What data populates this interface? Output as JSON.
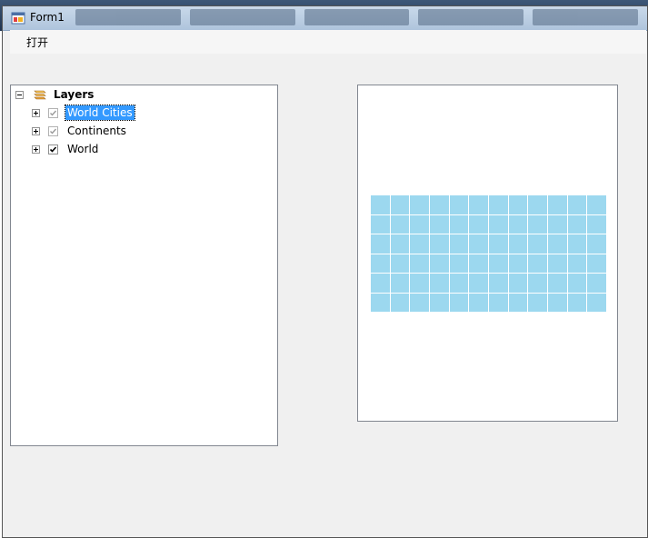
{
  "window": {
    "title": "Form1"
  },
  "menu": {
    "items": [
      {
        "label": "打开"
      }
    ]
  },
  "toc": {
    "root": {
      "label": "Layers"
    },
    "layers": [
      {
        "label": "World Cities",
        "checked": true,
        "dimmed": true,
        "selected": true
      },
      {
        "label": "Continents",
        "checked": true,
        "dimmed": true,
        "selected": false
      },
      {
        "label": "World",
        "checked": true,
        "dimmed": false,
        "selected": false
      }
    ]
  },
  "map": {
    "grid_rows": 6,
    "grid_cols": 12,
    "fill_color": "#9cd8ef"
  }
}
